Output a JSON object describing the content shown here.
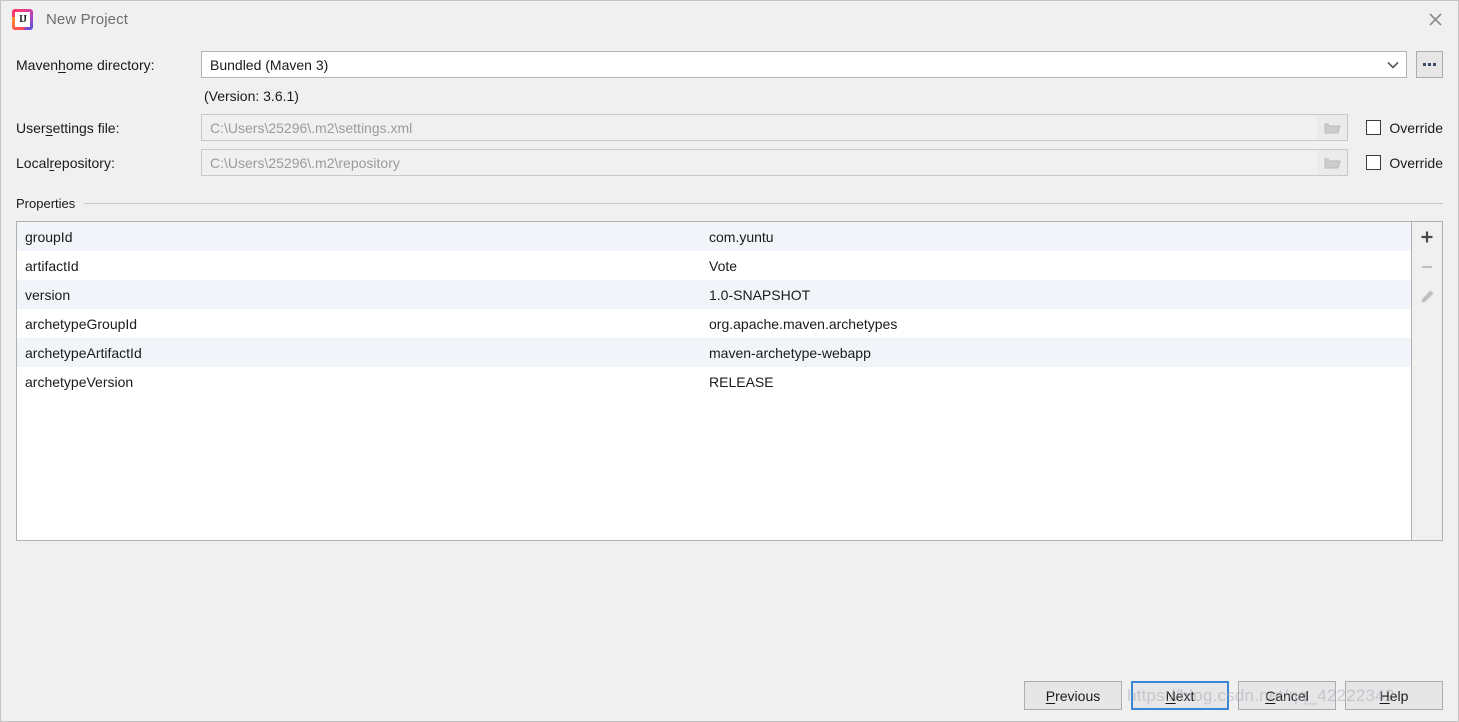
{
  "window": {
    "title": "New Project",
    "logo_text": "IJ",
    "close_icon": "close-icon"
  },
  "form": {
    "maven_home": {
      "label_pre": "Maven ",
      "label_mnemonic": "h",
      "label_post": "ome directory:",
      "value": "Bundled (Maven 3)",
      "arrow_icon": "chevron-down-icon",
      "browse_label": "..."
    },
    "version_note": "(Version: 3.6.1)",
    "user_settings": {
      "label_pre": "User ",
      "label_mnemonic": "s",
      "label_post": "ettings file:",
      "value": "C:\\Users\\25296\\.m2\\settings.xml",
      "folder_icon": "folder-icon",
      "override_label": "Override",
      "override_checked": false
    },
    "local_repository": {
      "label_pre": "Local ",
      "label_mnemonic": "r",
      "label_post": "epository:",
      "value": "C:\\Users\\25296\\.m2\\repository",
      "folder_icon": "folder-icon",
      "override_label": "Override",
      "override_checked": false
    }
  },
  "properties": {
    "group_title": "Properties",
    "rows": [
      {
        "key": "groupId",
        "value": "com.yuntu"
      },
      {
        "key": "artifactId",
        "value": "Vote"
      },
      {
        "key": "version",
        "value": "1.0-SNAPSHOT"
      },
      {
        "key": "archetypeGroupId",
        "value": "org.apache.maven.archetypes"
      },
      {
        "key": "archetypeArtifactId",
        "value": "maven-archetype-webapp"
      },
      {
        "key": "archetypeVersion",
        "value": "RELEASE"
      }
    ],
    "toolbar": [
      {
        "name": "add-property-button",
        "icon": "plus-icon",
        "enabled": true
      },
      {
        "name": "remove-property-button",
        "icon": "minus-icon",
        "enabled": false
      },
      {
        "name": "edit-property-button",
        "icon": "pencil-icon",
        "enabled": false
      }
    ]
  },
  "footer": {
    "previous": {
      "pre": "",
      "mnemonic": "P",
      "post": "revious"
    },
    "next": {
      "pre": "",
      "mnemonic": "N",
      "post": "ext"
    },
    "cancel": {
      "pre": "",
      "mnemonic": "C",
      "post": "ancel"
    },
    "help": {
      "pre": "",
      "mnemonic": "H",
      "post": "elp"
    }
  },
  "watermark": "https://blog.csdn.net/qq_42222342",
  "colors": {
    "dialog_bg": "#f0f0f0",
    "row_stripe": "#f1f5fa",
    "focus_blue": "#3b87d6",
    "disabled_text": "#9b9b9b"
  }
}
